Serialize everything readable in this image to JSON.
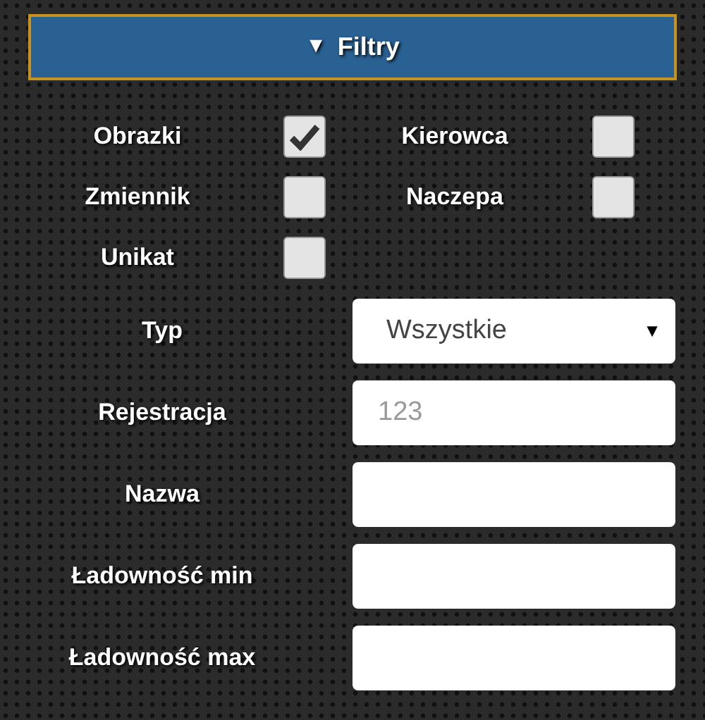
{
  "header": {
    "arrow": "▼",
    "title": "Filtry"
  },
  "checkboxes": [
    {
      "label": "Obrazki",
      "checked": true
    },
    {
      "label": "Kierowca",
      "checked": false
    },
    {
      "label": "Zmiennik",
      "checked": false
    },
    {
      "label": "Naczepa",
      "checked": false
    },
    {
      "label": "Unikat",
      "checked": false
    }
  ],
  "fields": [
    {
      "kind": "select",
      "label": "Typ",
      "value": "Wszystkie",
      "arrow": "▼"
    },
    {
      "kind": "text",
      "label": "Rejestracja",
      "placeholder": "123"
    },
    {
      "kind": "text",
      "label": "Nazwa"
    },
    {
      "kind": "text",
      "label": "Ładowność min"
    },
    {
      "kind": "text",
      "label": "Ładowność max"
    }
  ]
}
